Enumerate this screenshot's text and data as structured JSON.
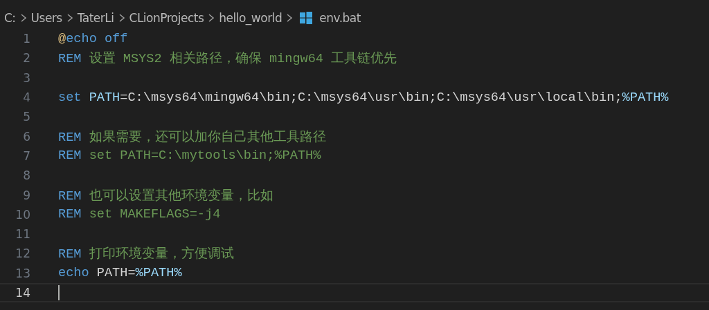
{
  "breadcrumb": [
    {
      "label": "C:",
      "kind": "folder"
    },
    {
      "label": "Users",
      "kind": "folder"
    },
    {
      "label": "TaterLi",
      "kind": "folder"
    },
    {
      "label": "CLionProjects",
      "kind": "folder"
    },
    {
      "label": "hello_world",
      "kind": "folder"
    },
    {
      "label": "env.bat",
      "kind": "file"
    }
  ],
  "lines": [
    {
      "number": "1",
      "current": false,
      "tokens": [
        {
          "kind": "at",
          "text": "@"
        },
        {
          "kind": "keyword",
          "text": "echo off"
        }
      ]
    },
    {
      "number": "2",
      "current": false,
      "tokens": [
        {
          "kind": "keyword",
          "text": "REM"
        },
        {
          "kind": "comment",
          "text": " 设置 MSYS2 相关路径，确保 mingw64 工具链优先"
        }
      ]
    },
    {
      "number": "3",
      "current": false
    },
    {
      "number": "4",
      "current": false,
      "tokens": [
        {
          "kind": "keyword",
          "text": "set"
        },
        {
          "kind": "variable",
          "text": " PATH"
        },
        {
          "kind": "plain",
          "text": "=C:\\msys64\\mingw64\\bin;C:\\msys64\\usr\\bin;C:\\msys64\\usr\\local\\bin;"
        },
        {
          "kind": "variable",
          "text": "%PATH%"
        }
      ]
    },
    {
      "number": "5",
      "current": false
    },
    {
      "number": "6",
      "current": false,
      "tokens": [
        {
          "kind": "keyword",
          "text": "REM"
        },
        {
          "kind": "comment",
          "text": " 如果需要，还可以加你自己其他工具路径"
        }
      ]
    },
    {
      "number": "7",
      "current": false,
      "tokens": [
        {
          "kind": "keyword",
          "text": "REM"
        },
        {
          "kind": "comment",
          "text": " set PATH=C:\\mytools\\bin;%PATH%"
        }
      ]
    },
    {
      "number": "8",
      "current": false
    },
    {
      "number": "9",
      "current": false,
      "tokens": [
        {
          "kind": "keyword",
          "text": "REM"
        },
        {
          "kind": "comment",
          "text": " 也可以设置其他环境变量，比如"
        }
      ]
    },
    {
      "number": "10",
      "current": false,
      "tokens": [
        {
          "kind": "keyword",
          "text": "REM"
        },
        {
          "kind": "comment",
          "text": " set MAKEFLAGS=-j4"
        }
      ]
    },
    {
      "number": "11",
      "current": false
    },
    {
      "number": "12",
      "current": false,
      "tokens": [
        {
          "kind": "keyword",
          "text": "REM"
        },
        {
          "kind": "comment",
          "text": " 打印环境变量，方便调试"
        }
      ]
    },
    {
      "number": "13",
      "current": false,
      "tokens": [
        {
          "kind": "keyword",
          "text": "echo"
        },
        {
          "kind": "plain",
          "text": " PATH="
        },
        {
          "kind": "variable",
          "text": "%PATH%"
        }
      ]
    },
    {
      "number": "14",
      "current": true
    }
  ]
}
